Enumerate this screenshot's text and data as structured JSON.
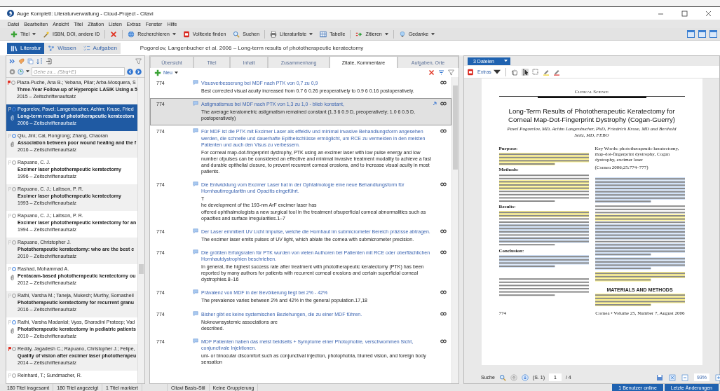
{
  "window": {
    "title": "Auge Komplett: Literaturverwaltung - Cloud-Project - Citavi"
  },
  "menu": [
    "Datei",
    "Bearbeiten",
    "Ansicht",
    "Titel",
    "Zitation",
    "Listen",
    "Extras",
    "Fenster",
    "Hilfe"
  ],
  "toolbar": [
    {
      "kind": "plus",
      "label": "Titel",
      "dropdown": true
    },
    {
      "kind": "wand",
      "label": "ISBN, DOI, andere ID",
      "dropdown": false
    },
    {
      "kind": "delete",
      "dropdown": false
    },
    {
      "kind": "globe",
      "label": "Recherchieren",
      "dropdown": true
    },
    {
      "kind": "pdf",
      "label": "Volltexte finden",
      "dropdown": false
    },
    {
      "kind": "search",
      "label": "Suchen",
      "dropdown": false
    },
    {
      "kind": "printer",
      "label": "Literaturliste",
      "dropdown": true
    },
    {
      "kind": "table",
      "label": "Tabelle",
      "dropdown": false
    },
    {
      "kind": "cite",
      "label": "Zitieren",
      "dropdown": true
    },
    {
      "kind": "bulb",
      "label": "Gedanke",
      "dropdown": true
    }
  ],
  "nav": {
    "tabs": [
      {
        "label": "Literatur",
        "kind": "books",
        "selected": true
      },
      {
        "label": "Wissen",
        "kind": "ideas",
        "selected": false
      },
      {
        "label": "Aufgaben",
        "kind": "tasks",
        "selected": false
      }
    ],
    "current_title": "Pogorelov, Langenbucher et al. 2006 – Long-term results of phototherapeutic keratectomy"
  },
  "references": {
    "search": {
      "placeholder": "Gehe zu... (Strg+E)"
    },
    "items": [
      {
        "authors": "Plaza-Puche, Ana B.; Yebana, Pilar; Arba-Mosquera, S",
        "title": "Three-Year Follow-up of Hyperopic LASIK Using a 5",
        "meta": "2015 – Zeitschriftenaufsatz",
        "flagged": true,
        "attachment": false,
        "selected": false
      },
      {
        "authors": "Pogorelov, Pavel; Langenbucher, Achim; Kruse, Fried",
        "title": "Long-term results of phototherapeutic keratectom",
        "meta": "2006 – Zeitschriftenaufsatz",
        "flagged": false,
        "attachment": true,
        "selected": true
      },
      {
        "authors": "Qiu, Jini; Cai, Rongrong; Zhang, Chaoran",
        "title": "Association between poor wound healing and the f",
        "meta": "2016 – Zeitschriftenaufsatz",
        "flagged": false,
        "attachment": true,
        "selected": false
      },
      {
        "authors": "Rapuano, C. J.",
        "title": "Excimer laser phototherapeutic keratectomy",
        "meta": "1996 – Zeitschriftenaufsatz",
        "flagged": false,
        "attachment": false,
        "selected": false
      },
      {
        "authors": "Rapuano, C. J.; Laibson, P. R.",
        "title": "Excimer laser phototherapeutic keratectomy",
        "meta": "1993 – Zeitschriftenaufsatz",
        "flagged": false,
        "attachment": false,
        "selected": false
      },
      {
        "authors": "Rapuano, C. J.; Laibson, P. R.",
        "title": "Excimer laser phototherapeutic keratectomy for an",
        "meta": "1994 – Zeitschriftenaufsatz",
        "flagged": false,
        "attachment": false,
        "selected": false
      },
      {
        "authors": "Rapuano, Christopher J.",
        "title": "Phototherapeutic keratectomy: who are the best c",
        "meta": "2010 – Zeitschriftenaufsatz",
        "flagged": false,
        "attachment": false,
        "selected": false
      },
      {
        "authors": "Rashad, Mohammad A.",
        "title": "Pentacam-based phototherapeutic keratectomy ou",
        "meta": "2012 – Zeitschriftenaufsatz",
        "flagged": false,
        "attachment": true,
        "selected": false
      },
      {
        "authors": "Rathi, Varsha M.; Taneja, Mukesh; Murthy, Somasheil",
        "title": "Phototherapeutic keratectomy for recurrent granu",
        "meta": "2016 – Zeitschriftenaufsatz",
        "flagged": false,
        "attachment": false,
        "selected": false
      },
      {
        "authors": "Rathi, Varsha Madanlal; Vyas, Sharadini Prateep; Vad",
        "title": "Phototherapeutic keratectomy in pediatric patients",
        "meta": "2010 – Zeitschriftenaufsatz",
        "flagged": false,
        "attachment": true,
        "selected": false
      },
      {
        "authors": "Reddy, Jagadesh C.; Rapuano, Christopher J.; Felipe,",
        "title": "Quality of vision after excimer laser phototherapeu",
        "meta": "2014 – Zeitschriftenaufsatz",
        "flagged": true,
        "attachment": false,
        "selected": false
      },
      {
        "authors": "Reinhard, T.; Sundmacher, R.",
        "flagged": false,
        "attachment": false,
        "selected": false
      }
    ]
  },
  "detail_tabs": [
    {
      "label": "Übersicht",
      "selected": false
    },
    {
      "label": "Titel",
      "selected": false
    },
    {
      "label": "Inhalt",
      "selected": false
    },
    {
      "label": "Zusammenhang",
      "selected": false
    },
    {
      "label": "Zitate, Kommentare",
      "selected": true
    },
    {
      "label": "Aufgaben, Orte",
      "selected": false
    }
  ],
  "new_button": "Neu",
  "quotes": [
    {
      "page": "774",
      "comment": "Visusverbesserung bei MDF nach PTK von 0,7 zu 0,9",
      "quote": "Best corrected visual acuity increased from 0.7 6 0.26 preoperatively to 0.9 6 0.16 postoperatively.",
      "selected": false
    },
    {
      "page": "774",
      "comment": "Astigmatismus bei MDF nach PTK von 1,3 zu 1,0 - blieb konstant,",
      "quote": "The average keratometric astigmatism remained constant (1.3 6 0.9 D, preoperatively; 1.0 6 0.5 D, postoperatively)",
      "selected": true
    },
    {
      "page": "774",
      "comment": "Für MDF ist die PTK mit Excimer Laser als effektiv und minimal invasive Behandlungsform angesehen werden, die schnelle und dauerhafte Epithelschlüsse ermöglicht, um RCE zu vermeiden in den meisten Patienten und auch den Visus zu verbessern.",
      "quote": "For corneal map-dot-fingerprint dystrophy, PTK using an excimer laser with low pulse energy and low number ofpulses can be considered an effective and minimal invasive treatment modality to achieve a fast and durable epithelial closure, to prevent recurrent corneal erosions, and to increase visual acuity in most patients.",
      "selected": false
    },
    {
      "page": "774",
      "comment": "Die Entwicklung vom Excimer Laser hat in der Ophtalmologie eine neue Behandlungsform für Hornhautirregularittn und Opacitis eingeführt.",
      "quote": "T\nhe development of the 193-nm ArF excimer laser has\noffered ophthalmologists a new surgical tool in the treatment ofsuperficial corneal abnormalities such as opacities and surface irregularities.1–7",
      "selected": false
    },
    {
      "page": "774",
      "comment": "Der Laser emmitiert UV Licht Impulse, welche die Hornhaut im submicrometer Bereich präzisse abtragen.",
      "quote": "The excimer laser emits pulses of UV light, which ablate the cornea with submicrometer precision.",
      "selected": false
    },
    {
      "page": "774",
      "comment": "Die größten Erfolgsraten für PTK wurden von vielen Authoren bei Patienten mit RCE oder oberflächlichen Hornhautdystrophien beschrieben.",
      "quote": "In general, the highest success rate after treatment with phototherapeutic keratectomy (PTK) has been reported by many authors for patients with recurrent corneal erosions and certain superficial corneal dystrophies.8–16",
      "selected": false
    },
    {
      "page": "774",
      "comment": "Prävalenz von MDF in der Bevölkerung liegt bei 2% - 42%",
      "quote": "The prevalence varies between 2% and 42% in the general population.17,18",
      "selected": false
    },
    {
      "page": "774",
      "comment": "Bisher gibt es keine systemischen Beziehungen, die zu einer MDF führen.",
      "quote": "Noknownsystemic associations are\ndescribed.",
      "selected": false
    },
    {
      "page": "774",
      "comment": "MDF Patienten haben das meist beidseits + Symptome einer Photophobie, verschwommen Sicht, conjunctivale Injektionen.",
      "quote": "uni- or binocular discomfort such as conjunctival injection, photophobia, blurred vision, and foreign body sensation",
      "selected": false
    }
  ],
  "pdf": {
    "file_selector": "3 Dateien",
    "extras": "Extras",
    "page": {
      "section": "Clinical Science",
      "title": "Long-Term Results of Phototherapeutic Keratectomy for Corneal Map-Dot-Fingerprint Dystrophy (Cogan-Guerry)",
      "authors": "Pavel Pogorelov, MD, Achim Langenbucher, PhD, Friedrich Kruse, MD and Berthold Seitz, MD, FEBO",
      "abstract_labels": [
        "Purpose:",
        "Methods:",
        "Results:",
        "Conclusion:"
      ],
      "key_words": "Key Words: phototherapeutic keratectomy, map-dot-fingerprint dystrophy, Cogan dystrophy, excimer laser",
      "citation": "(Cornea 2006;25:774–777)",
      "heading": "MATERIALS AND METHODS",
      "page_number": "774",
      "footer": "Cornea • Volume 25, Number 7, August 2006"
    },
    "search_label": "Suche",
    "page_label": "(S. 1)",
    "page_input": "1",
    "page_total": "/ 4",
    "zoom": "93%"
  },
  "status_bar": {
    "counts": [
      "180 Titel insgesamt",
      "180 Titel angezeigt",
      "1 Titel markiert"
    ],
    "style": "Citavi Basis-Stil",
    "grouping": "Keine Gruppierung",
    "users_online": "1 Benutzer online",
    "recent_changes": "Letzte Änderungen"
  }
}
